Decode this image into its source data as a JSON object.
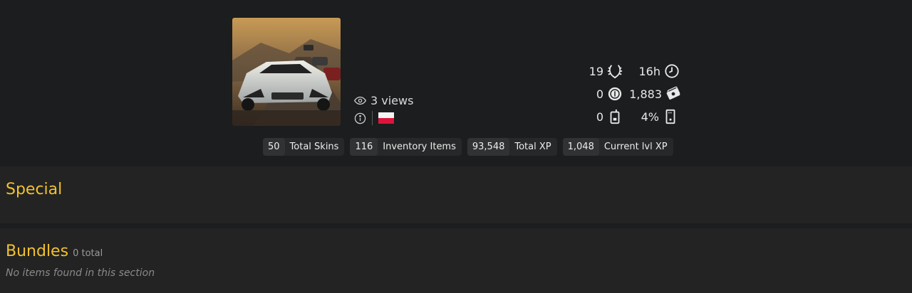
{
  "profile": {
    "views": "3 views",
    "colors": {
      "accent": "#f2c12e",
      "flag_white": "#f4f4f4",
      "flag_red": "#dc143c"
    }
  },
  "stats": {
    "laurels": {
      "value": "19",
      "icon": "laurel-wreath-icon"
    },
    "playtime": {
      "value": "16h",
      "icon": "clock-icon"
    },
    "coins": {
      "value": "0",
      "icon": "coin-icon"
    },
    "cash": {
      "value": "1,883",
      "icon": "cash-icon"
    },
    "phones": {
      "value": "0",
      "icon": "phone-icon"
    },
    "progress": {
      "value": "4%",
      "icon": "door-icon"
    }
  },
  "chips": [
    {
      "num": "50",
      "label": "Total Skins"
    },
    {
      "num": "116",
      "label": "Inventory Items"
    },
    {
      "num": "93,548",
      "label": "Total XP"
    },
    {
      "num": "1,048",
      "label": "Current lvl XP"
    }
  ],
  "sections": {
    "special": {
      "title": "Special"
    },
    "bundles": {
      "title": "Bundles",
      "count": "0 total",
      "empty": "No items found in this section"
    }
  }
}
